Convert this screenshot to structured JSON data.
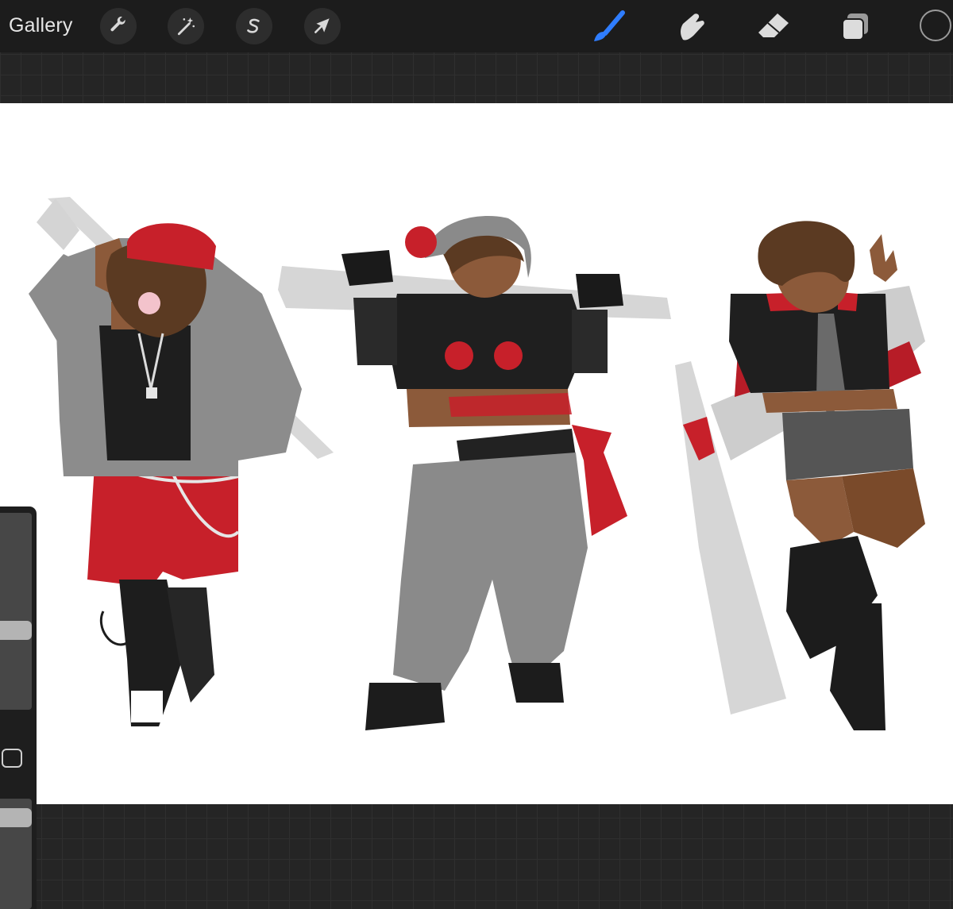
{
  "toolbar": {
    "gallery_label": "Gallery",
    "left_tools": [
      {
        "name": "actions",
        "icon": "wrench-icon"
      },
      {
        "name": "adjustments",
        "icon": "magic-wand-icon"
      },
      {
        "name": "selection",
        "icon": "selection-s-icon"
      },
      {
        "name": "transform",
        "icon": "arrow-cursor-icon"
      }
    ],
    "right_tools": [
      {
        "name": "brush",
        "icon": "brush-icon",
        "active": true
      },
      {
        "name": "smudge",
        "icon": "smudge-finger-icon",
        "active": false
      },
      {
        "name": "eraser",
        "icon": "eraser-icon",
        "active": false
      },
      {
        "name": "layers",
        "icon": "layers-icon",
        "active": false
      }
    ],
    "color_icon": "color-circle-icon",
    "active_color": "#2f7dff"
  },
  "sidebar": {
    "brush_size_level": 0.6,
    "opacity_level": 0.7,
    "modify_icon": "modify-square-icon"
  },
  "canvas": {
    "artwork": "three-character-outfit-illustrations",
    "palette": {
      "red": "#c7202a",
      "dark": "#1f1f1f",
      "gray": "#8a8a8a",
      "light_gray": "#c8c8c8",
      "skin": "#8c5a3a",
      "hair": "#5b3a22"
    }
  }
}
